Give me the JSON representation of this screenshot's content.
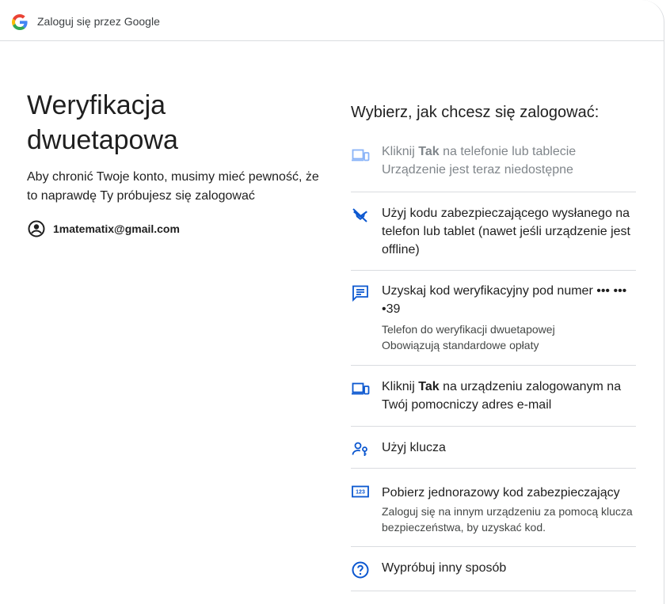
{
  "header": {
    "title": "Zaloguj się przez Google",
    "logo_icon": "google-g-logo"
  },
  "left": {
    "title": "Weryfikacja dwuetapowa",
    "description": "Aby chronić Twoje konto, musimy mieć pewność, że to naprawdę Ty próbujesz się zalogować",
    "account_icon": "account-circle-icon",
    "email": "1matematix@gmail.com"
  },
  "right": {
    "title": "Wybierz, jak chcesz się zalogować:",
    "options": [
      {
        "icon": "devices-icon",
        "main_pre": "Kliknij ",
        "main_bold": "Tak",
        "main_post": " na telefonie lub tablecie",
        "sub": "Urządzenie jest teraz niedostępne",
        "disabled": true
      },
      {
        "icon": "phonelink-lock-icon",
        "main": "Użyj kodu zabezpieczającego wysłanego na telefon lub tablet (nawet jeśli urządzenie jest offline)"
      },
      {
        "icon": "sms-icon",
        "main": "Uzyskaj kod weryfikacyjny pod numer ••• ••• •39",
        "sub1": "Telefon do weryfikacji dwuetapowej",
        "sub2": "Obowiązują standardowe opłaty"
      },
      {
        "icon": "devices-icon",
        "main_pre": "Kliknij ",
        "main_bold": "Tak",
        "main_post": " na urządzeniu zalogowanym na Twój pomocniczy adres e-mail"
      },
      {
        "icon": "passkey-icon",
        "main": "Użyj klucza"
      },
      {
        "icon": "pin-123-icon",
        "main": "Pobierz jednorazowy kod zabezpieczający",
        "sub": "Zaloguj się na innym urządzeniu za pomocą klucza bezpieczeństwa, by uzyskać kod."
      },
      {
        "icon": "help-circle-icon",
        "main": "Wypróbuj inny sposób"
      }
    ]
  },
  "colors": {
    "accent": "#0b57d0",
    "disabled": "#80868b",
    "divider": "#dadce0",
    "text": "#1f1f1f"
  }
}
